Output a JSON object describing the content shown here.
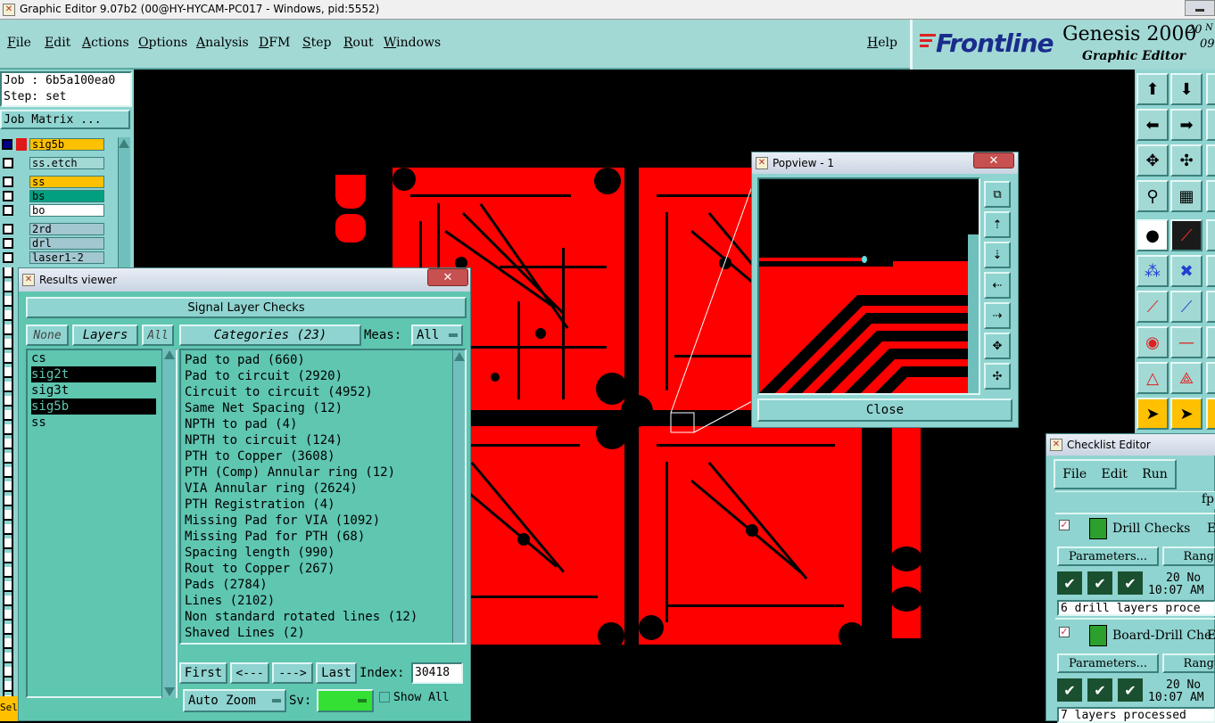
{
  "window": {
    "title": "Graphic Editor 9.07b2 (00@HY-HYCAM-PC017 - Windows, pid:5552)"
  },
  "menu": {
    "items": [
      "File",
      "Edit",
      "Actions",
      "Options",
      "Analysis",
      "DFM",
      "Step",
      "Rout",
      "Windows"
    ],
    "help": "Help"
  },
  "logo": {
    "brand": "Frontline",
    "product": "Genesis 2000",
    "subtitle": "Graphic Editor",
    "date_a": "20",
    "date_b": "N",
    "date_c": "09"
  },
  "job": {
    "job_label": "Job : 6b5a100ea0",
    "step_label": "Step: set",
    "matrix_button": "Job Matrix ..."
  },
  "layers": [
    {
      "name": "sig5b",
      "color": "#ffc000"
    },
    {
      "name": "ss.etch",
      "color": "#a2d9d5"
    },
    {
      "name": "ss",
      "color": "#ffc000"
    },
    {
      "name": "bs",
      "color": "#00a080"
    },
    {
      "name": "bo",
      "color": "#ffffff"
    },
    {
      "name": "2rd",
      "color": "#a2c7d0"
    },
    {
      "name": "drl",
      "color": "#a2c7d0"
    },
    {
      "name": "laser1-2",
      "color": "#a2c7d0"
    }
  ],
  "results": {
    "title": "Results viewer",
    "header": "Signal Layer Checks",
    "none_btn": "None",
    "layers_btn": "Layers",
    "all_btn": "All",
    "categories_btn": "Categories (23)",
    "meas_label": "Meas:",
    "meas_value": "All",
    "layer_list": [
      {
        "name": "cs",
        "selected": false
      },
      {
        "name": "sig2t",
        "selected": true
      },
      {
        "name": "sig3t",
        "selected": false
      },
      {
        "name": "sig5b",
        "selected": true
      },
      {
        "name": "ss",
        "selected": false
      }
    ],
    "categories": [
      "Pad to pad (660)",
      "Pad to circuit (2920)",
      "Circuit to circuit (4952)",
      "Same Net Spacing (12)",
      "NPTH to pad (4)",
      "NPTH to circuit (124)",
      "PTH to Copper (3608)",
      "PTH (Comp) Annular ring (12)",
      "VIA Annular ring (2624)",
      "PTH Registration (4)",
      "Missing Pad for VIA (1092)",
      "Missing Pad for PTH (68)",
      "Spacing length (990)",
      "Rout to Copper (267)",
      "Pads (2784)",
      "Lines (2102)",
      "Non standard rotated lines (12)",
      "Shaved Lines (2)"
    ],
    "first_btn": "First",
    "prev_btn": "<---",
    "next_btn": "--->",
    "last_btn": "Last",
    "index_label": "Index:",
    "index_value": "30418",
    "autozoom_btn": "Auto Zoom",
    "sv_label": "Sv:",
    "show_all": "Show All",
    "bottom_left": "Sel"
  },
  "popview": {
    "title": "Popview - 1",
    "close_btn": "Close"
  },
  "checklist": {
    "title": "Checklist Editor",
    "menu": [
      "File",
      "Edit",
      "Run"
    ],
    "name_fragment": "fp",
    "checks": [
      {
        "name": "Drill Checks",
        "params": "Parameters...",
        "range": "Rang",
        "date": "20 No",
        "time": "10:07 AM",
        "status": "6 drill layers proce",
        "extra": "E"
      },
      {
        "name": "Board-Drill Che",
        "params": "Parameters...",
        "range": "Rang",
        "date": "20 No",
        "time": "10:07 AM",
        "status": "7 layers processed",
        "extra": "E"
      }
    ]
  },
  "colors": {
    "accent": "#8fd4d0",
    "copper": "#ff0000",
    "list_bg": "#5fc6b0",
    "selected": "#000000"
  }
}
